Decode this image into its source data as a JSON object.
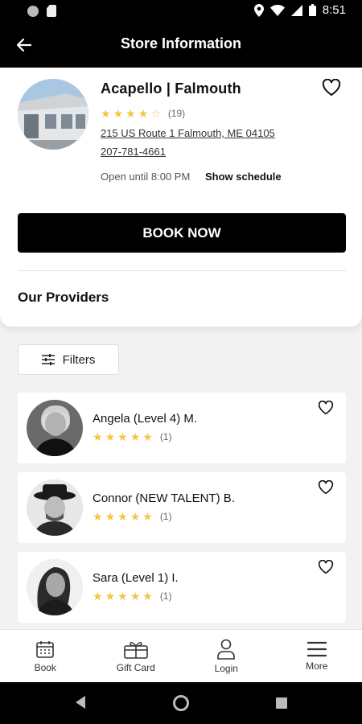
{
  "status_bar": {
    "time": "8:51"
  },
  "app_bar": {
    "title": "Store Information"
  },
  "store": {
    "name": "Acapello | Falmouth",
    "rating": 4,
    "rating_count": "(19)",
    "address": "215 US Route 1 Falmouth, ME 04105",
    "phone": "207-781-4661",
    "hours": "Open until 8:00 PM",
    "show_schedule": "Show schedule",
    "book_label": "BOOK NOW",
    "providers_heading": "Our Providers"
  },
  "filters": {
    "label": "Filters"
  },
  "providers": [
    {
      "name": "Angela (Level 4) M.",
      "rating": 5,
      "count": "(1)"
    },
    {
      "name": "Connor (NEW TALENT) B.",
      "rating": 5,
      "count": "(1)"
    },
    {
      "name": "Sara (Level 1) I.",
      "rating": 5,
      "count": "(1)"
    }
  ],
  "bottom_nav": [
    {
      "label": "Book",
      "icon": "calendar-icon"
    },
    {
      "label": "Gift Card",
      "icon": "gift-card-icon"
    },
    {
      "label": "Login",
      "icon": "user-icon"
    },
    {
      "label": "More",
      "icon": "menu-icon"
    }
  ],
  "colors": {
    "accent": "#000000",
    "star": "#f4c542",
    "background": "#f2f2f2"
  }
}
